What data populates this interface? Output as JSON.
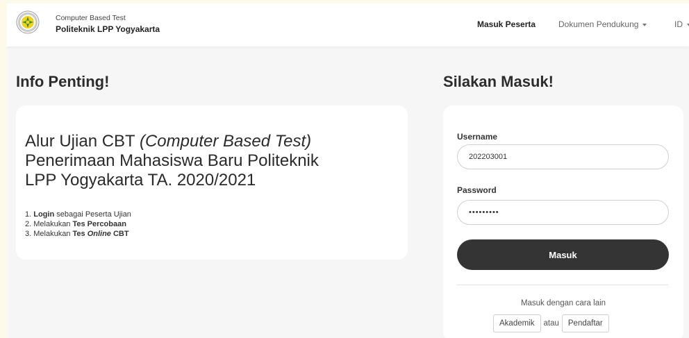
{
  "navbar": {
    "brand_sub": "Computer Based Test",
    "brand_main": "Politeknik LPP Yogyakarta",
    "items": [
      {
        "label": "Masuk Peserta",
        "active": true
      },
      {
        "label": "Dokumen Pendukung",
        "dropdown": true
      },
      {
        "label": "ID",
        "dropdown": true
      }
    ]
  },
  "info": {
    "heading": "Info Penting!",
    "title_start": "Alur Ujian CBT ",
    "title_italic": "(Computer Based Test)",
    "title_end": " Penerimaan Mahasiswa Baru Politeknik LPP Yogyakarta TA. 2020/2021",
    "steps": [
      {
        "num": "1. ",
        "bold": "Login",
        "rest": " sebagai Peserta Ujian"
      },
      {
        "num": "2. Melakukan ",
        "bold": "Tes Percobaan"
      },
      {
        "num": "3. Melakukan ",
        "bold": "Tes ",
        "bold_italic": "Online",
        "rest_bold": " CBT"
      }
    ]
  },
  "login": {
    "heading": "Silakan Masuk!",
    "username_label": "Username",
    "username_value": "202203001",
    "password_label": "Password",
    "password_value": "•••••••••",
    "submit_label": "Masuk",
    "alt_text": "Masuk dengan cara lain",
    "alt_akademik": "Akademik",
    "alt_or": "atau",
    "alt_pendaftar": "Pendaftar"
  },
  "colors": {
    "background": "#f6f6f6",
    "button_dark": "#343434",
    "logo_yellow": "#f2d21a",
    "logo_green": "#2e8b3a"
  }
}
